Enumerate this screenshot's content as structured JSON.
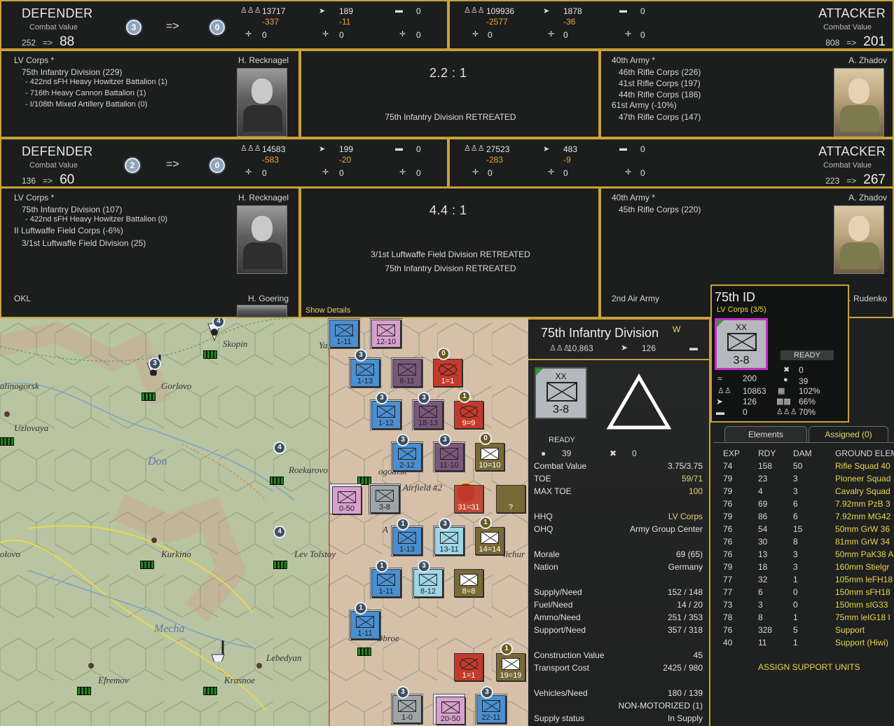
{
  "battle1": {
    "defender": {
      "title": "DEFENDER",
      "cv_label": "Combat Value",
      "cv_start": "252",
      "cv_arrow": "=>",
      "cv_end": "88",
      "before": "3",
      "arrow": "=>",
      "after": "0",
      "men": "13717",
      "men_loss": "-337",
      "guns": "189",
      "guns_loss": "-11",
      "afv": "0",
      "air1": "0",
      "air2": "0",
      "air3": "0"
    },
    "attacker": {
      "title": "ATTACKER",
      "cv_label": "Combat Value",
      "cv_start": "808",
      "cv_arrow": "=>",
      "cv_end": "201",
      "men": "109936",
      "men_loss": "-2577",
      "guns": "1878",
      "guns_loss": "-36",
      "afv": "0",
      "air1": "0",
      "air2": "0",
      "air3": "0"
    },
    "def_hq": "LV Corps *",
    "def_leader": "H. Recknagel",
    "def_units": [
      "75th Infantry Division (229)",
      "- 422nd sFH Heavy Howitzer Battalion (1)",
      "- 716th Heavy Cannon Battalion (1)",
      "- I/108th Mixed Artillery Battalion (0)"
    ],
    "ratio": "2.2 : 1",
    "results": [
      "75th Infantry Division RETREATED"
    ],
    "att_hq": "40th Army *",
    "att_leader": "A. Zhadov",
    "att_units": [
      "46th Rifle Corps (226)",
      "41st Rifle Corps (197)",
      "44th Rifle Corps (186)",
      "61st Army (-10%)",
      "47th Rifle Corps (147)"
    ]
  },
  "battle2": {
    "defender": {
      "title": "DEFENDER",
      "cv_label": "Combat Value",
      "cv_start": "136",
      "cv_arrow": "=>",
      "cv_end": "60",
      "before": "2",
      "arrow": "=>",
      "after": "0",
      "men": "14583",
      "men_loss": "-583",
      "guns": "199",
      "guns_loss": "-20",
      "afv": "0",
      "air1": "0",
      "air2": "0",
      "air3": "0"
    },
    "attacker": {
      "title": "ATTACKER",
      "cv_label": "Combat Value",
      "cv_start": "223",
      "cv_arrow": "=>",
      "cv_end": "267",
      "men": "27523",
      "men_loss": "-283",
      "guns": "483",
      "guns_loss": "-9",
      "afv": "0",
      "air1": "0",
      "air2": "0",
      "air3": "0"
    },
    "def_hq": "LV Corps *",
    "def_leader": "H. Recknagel",
    "def_units": [
      "75th Infantry Division (107)",
      "- 422nd sFH Heavy Howitzer Battalion (0)",
      "II Luftwaffe Field Corps (-6%)",
      "3/1st Luftwaffe Field Division (25)"
    ],
    "def_air": "OKL",
    "def_air_leader": "H. Goering",
    "ratio": "4.4 : 1",
    "results": [
      "3/1st Luftwaffe Field Division RETREATED",
      "75th Infantry Division RETREATED"
    ],
    "show_details": "Show Details",
    "att_hq": "40th Army *",
    "att_leader": "A. Zhadov",
    "att_units": [
      "45th Rifle Corps (220)"
    ],
    "att_air": "2nd Air Army",
    "att_air_leader": "A. Rudenko"
  },
  "map": {
    "cities": [
      "Skopin",
      "Gorlovo",
      "alinogorsk",
      "Uzlovaya",
      "Roekurovo",
      "Kurkino",
      "Lev Tolstoy",
      "Efremov",
      "Krasnoe",
      "Lebedyan",
      "olovo",
      "Obroe",
      "Airfield #2",
      "A",
      "Yazhelsk",
      "ogodisk",
      "lichur"
    ],
    "rivers": [
      "Don",
      "Mecha"
    ],
    "counters": [
      {
        "val": "1-11",
        "color": "blue"
      },
      {
        "val": "12-10",
        "color": "pink"
      },
      {
        "val": "1-13",
        "color": "blue",
        "badge": "3"
      },
      {
        "val": "8-11",
        "color": "purple"
      },
      {
        "val": "1=1",
        "color": "red",
        "badge": "0"
      },
      {
        "val": "1-12",
        "color": "blue",
        "badge": "3"
      },
      {
        "val": "18-13",
        "color": "purple",
        "badge": "3"
      },
      {
        "val": "9=9",
        "color": "red",
        "badge": "1"
      },
      {
        "val": "2-12",
        "color": "blue",
        "badge": "3"
      },
      {
        "val": "11-10",
        "color": "purple",
        "badge": "3"
      },
      {
        "val": "10=10",
        "color": "olive",
        "badge": "0"
      },
      {
        "val": "0-50",
        "color": "pink"
      },
      {
        "val": "3-8",
        "color": "grey"
      },
      {
        "val": "31=31",
        "color": "red"
      },
      {
        "val": "?",
        "color": "olive"
      },
      {
        "val": "1-13",
        "color": "blue",
        "badge": "1"
      },
      {
        "val": "13-11",
        "color": "lblue",
        "badge": "3"
      },
      {
        "val": "14=14",
        "color": "olive",
        "badge": "1"
      },
      {
        "val": "1-11",
        "color": "blue",
        "badge": "1"
      },
      {
        "val": "8-12",
        "color": "lblue",
        "badge": "3"
      },
      {
        "val": "8=8",
        "color": "olive"
      },
      {
        "val": "1-11",
        "color": "blue",
        "badge": "1"
      },
      {
        "val": "1=1",
        "color": "red"
      },
      {
        "val": "19=19",
        "color": "olive",
        "badge": "1"
      },
      {
        "val": "1-0",
        "color": "grey",
        "badge": "3"
      },
      {
        "val": "20-50",
        "color": "pink"
      },
      {
        "val": "22-11",
        "color": "blue",
        "badge": "3"
      }
    ],
    "hq_badges": [
      "4",
      "3",
      "4",
      "4",
      "4"
    ]
  },
  "detail": {
    "name": "75th Infantry Division",
    "w_mark": "W",
    "men": "10,863",
    "guns": "126",
    "counter_xx": "XX",
    "counter_val": "3-8",
    "status": "READY",
    "fatigue": "39",
    "fortify": "0",
    "rows": [
      {
        "k": "Combat Value",
        "v": "3.75/3.75"
      },
      {
        "k": "TOE",
        "v": "59/71",
        "yellow": true
      },
      {
        "k": "MAX TOE",
        "v": "100",
        "yellow": true
      },
      {
        "k": "HHQ",
        "v": "LV Corps",
        "yellow": true
      },
      {
        "k": "OHQ",
        "v": "Army Group Center"
      },
      {
        "k": "Morale",
        "v": "69 (65)"
      },
      {
        "k": "Nation",
        "v": "Germany"
      },
      {
        "k": "Supply/Need",
        "v": "152 / 148"
      },
      {
        "k": "Fuel/Need",
        "v": "14 / 20"
      },
      {
        "k": "Ammo/Need",
        "v": "251 / 353"
      },
      {
        "k": "Support/Need",
        "v": "357 / 318"
      },
      {
        "k": "Construction Value",
        "v": "45"
      },
      {
        "k": "Transport Cost",
        "v": "2425 / 980"
      },
      {
        "k": "Vehicles/Need",
        "v": "180 / 139"
      },
      {
        "k": "",
        "v": "NON-MOTORIZED (1)"
      },
      {
        "k": "Supply status",
        "v": "In Supply"
      }
    ]
  },
  "popup": {
    "title": "75th ID",
    "subtitle": "LV Corps (3/5)",
    "counter_xx": "XX",
    "counter_val": "3-8",
    "status": "READY",
    "r1a": "200",
    "r1b": "39",
    "r2a": "10863",
    "r2b": "102%",
    "r3a": "126",
    "r3b": "66%",
    "r4a": "0",
    "r4b": "70%",
    "fort": "0"
  },
  "elements": {
    "tabs": [
      "Elements",
      "Assigned (0)"
    ],
    "headers": [
      "EXP",
      "RDY",
      "DAM",
      "GROUND ELEME"
    ],
    "rows": [
      [
        "74",
        "158",
        "50",
        "Rifle Squad 40"
      ],
      [
        "79",
        "23",
        "3",
        "Pioneer Squad"
      ],
      [
        "79",
        "4",
        "3",
        "Cavalry Squad"
      ],
      [
        "76",
        "69",
        "6",
        "7.92mm PzB 3"
      ],
      [
        "79",
        "86",
        "6",
        "7.92mm MG42"
      ],
      [
        "76",
        "54",
        "15",
        "50mm GrW 36"
      ],
      [
        "76",
        "30",
        "8",
        "81mm GrW 34"
      ],
      [
        "76",
        "13",
        "3",
        "50mm PaK38 A"
      ],
      [
        "79",
        "18",
        "3",
        "160mm Stielgr"
      ],
      [
        "77",
        "32",
        "1",
        "105mm leFH18"
      ],
      [
        "77",
        "6",
        "0",
        "150mm sFH18"
      ],
      [
        "73",
        "3",
        "0",
        "150mm sIG33"
      ],
      [
        "78",
        "8",
        "1",
        "75mm leIG18 I"
      ],
      [
        "76",
        "328",
        "5",
        "Support"
      ],
      [
        "40",
        "11",
        "1",
        "Support (Hiwi)"
      ]
    ],
    "assign": "ASSIGN SUPPORT UNITS"
  },
  "colors": {
    "gold": "#c8a13a",
    "loss": "#e7a23a",
    "yellow": "#e8d64a"
  }
}
